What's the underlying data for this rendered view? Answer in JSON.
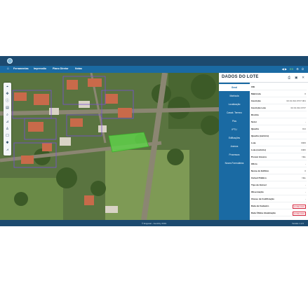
{
  "menu": {
    "items": [
      "Ferramentas",
      "Impressão",
      "Plano Diretor",
      "Notas"
    ]
  },
  "toolbar_right": {
    "items": [
      "◀ ▶",
      "ES",
      "⚙",
      "⏻"
    ]
  },
  "map_tools": [
    {
      "icon": "select-icon",
      "glyph": "⌖"
    },
    {
      "icon": "pan-icon",
      "glyph": "✥"
    },
    {
      "icon": "info-icon",
      "glyph": "ⓘ"
    },
    {
      "icon": "layers-icon",
      "glyph": "▤"
    },
    {
      "icon": "locate-icon",
      "glyph": "⌕"
    },
    {
      "icon": "measure-icon",
      "glyph": "⊿"
    },
    {
      "icon": "person-icon",
      "glyph": "♙"
    },
    {
      "icon": "comment-icon",
      "glyph": "☐"
    },
    {
      "icon": "settings-icon",
      "glyph": "✱"
    },
    {
      "icon": "chart-icon",
      "glyph": "⩘"
    }
  ],
  "panel": {
    "title": "DADOS DO LOTE",
    "header_icons": [
      "print-icon",
      "export-icon",
      "close-icon"
    ],
    "tabs": [
      "Geral",
      "Matrícula",
      "Localização",
      "Caract. Terreno",
      "Pics",
      "IPTU",
      "Edificações",
      "Anexos",
      "Processos",
      "Novos Formulários"
    ],
    "active_tab": "Geral",
    "fields": [
      {
        "label": "CIE",
        "value": "",
        "highlight": false
      },
      {
        "label": "Matrícula",
        "value": "0",
        "highlight": false
      },
      {
        "label": "Inscrição",
        "value": "02.01.014.0747.001",
        "highlight": false
      },
      {
        "label": "Inscrição Lote",
        "value": "02.01.014.0747",
        "highlight": false
      },
      {
        "label": "Distrito",
        "value": "",
        "highlight": false
      },
      {
        "label": "Setor",
        "value": "-",
        "highlight": false
      },
      {
        "label": "Quadra",
        "value": "014",
        "highlight": false
      },
      {
        "label": "Quadra (cartório)",
        "value": "",
        "highlight": false
      },
      {
        "label": "Lote",
        "value": "0006",
        "highlight": false
      },
      {
        "label": "Lote (cartório)",
        "value": "0482",
        "highlight": false
      },
      {
        "label": "Possui Anexos",
        "value": "Não",
        "highlight": false
      },
      {
        "label": "Oficio",
        "value": "-",
        "highlight": false
      },
      {
        "label": "Nome do Edifício",
        "value": "0",
        "highlight": false
      },
      {
        "label": "Imóvel Público",
        "value": "Não",
        "highlight": false
      },
      {
        "label": "Tipo de Imóvel",
        "value": "-",
        "highlight": false
      },
      {
        "label": "Observação",
        "value": "-",
        "highlight": false
      },
      {
        "label": "Classe de Codificação",
        "value": "-",
        "highlight": false
      },
      {
        "label": "Data de Cadastro",
        "value": "22/09/2016",
        "highlight": true
      },
      {
        "label": "Data Última Atualização",
        "value": "22/09/2016",
        "highlight": true
      }
    ]
  },
  "footer": {
    "center": "© Engesat - GeoCity 2019",
    "right": "Versão 1.2.0"
  },
  "colors": {
    "topbar": "#1c4a6f",
    "menubar": "#1a6aa3",
    "selected_lot": "#5fd04a",
    "lot_outline": "#7a4fd6",
    "map_green": "#5e7a3f"
  }
}
